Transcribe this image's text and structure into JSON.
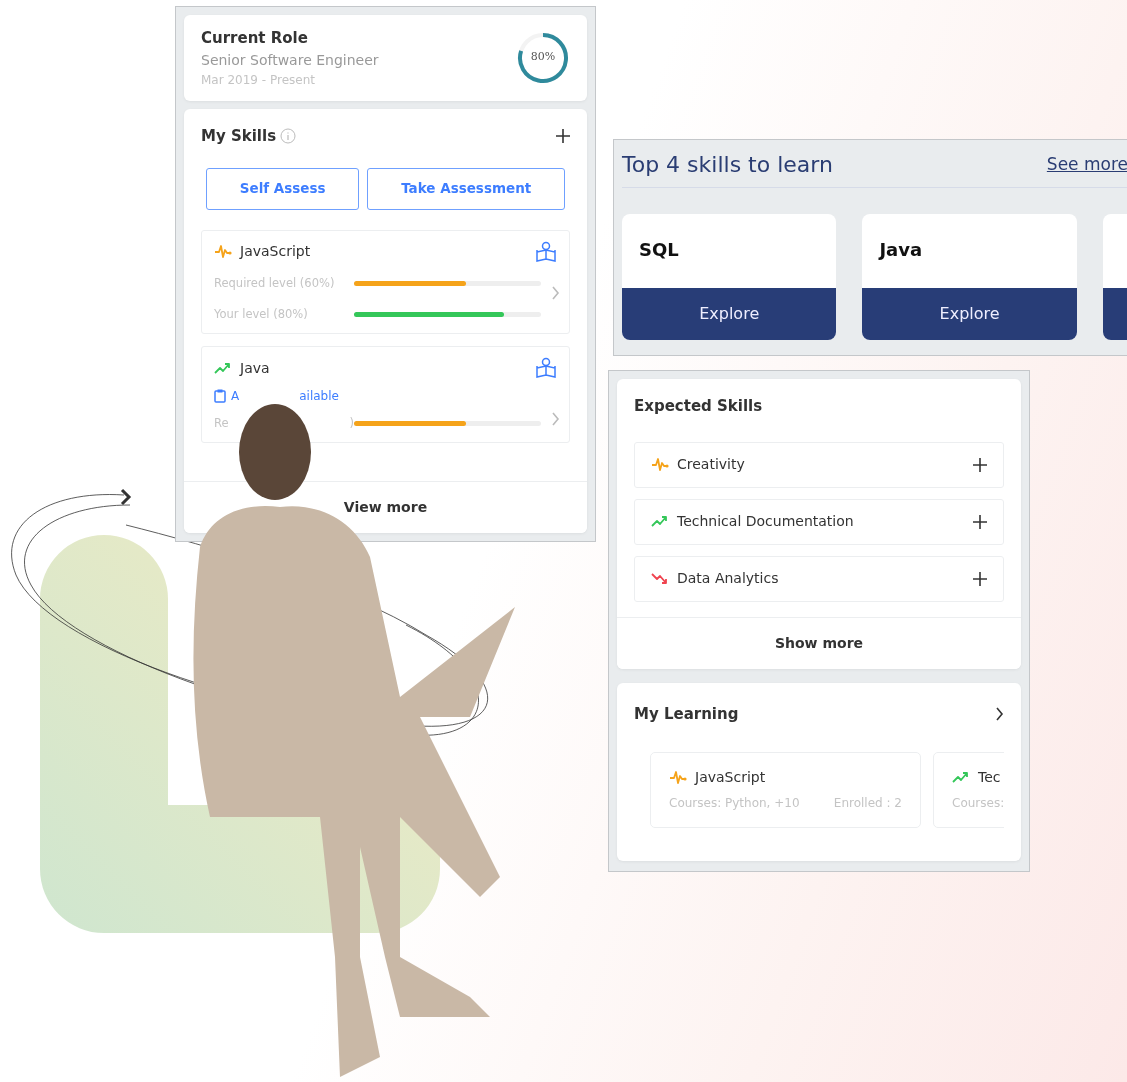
{
  "current_role": {
    "title": "Current Role",
    "role": "Senior Software Engineer",
    "period": "Mar 2019 - Present",
    "progress": {
      "level": 0.8,
      "reading": "80%"
    }
  },
  "my_skills": {
    "title": "My Skills",
    "buttons": [
      "Self Assess",
      "Take Assessment"
    ],
    "skills": [
      {
        "name": "JavaScript",
        "kind": "steady",
        "rows": [
          {
            "kind": "required",
            "label": "Required level (60%)",
            "level": 0.6
          },
          {
            "kind": "yours",
            "label": "Your level (80%)",
            "level": 0.8
          }
        ]
      },
      {
        "name": "Java",
        "kind": "up",
        "link_parts": [
          "A",
          "ailable"
        ],
        "rows": [
          {
            "kind": "required",
            "label_parts": [
              "Re",
              ")"
            ],
            "level": 0.6
          }
        ]
      }
    ],
    "footer": "View more"
  },
  "top_skills": {
    "title": "Top 4 skills to learn",
    "link": "See more",
    "cards": [
      {
        "name": "SQL",
        "action": "Explore"
      },
      {
        "name": "Java",
        "action": "Explore"
      }
    ]
  },
  "expected_skills": {
    "title": "Expected Skills",
    "items": [
      {
        "name": "Creativity",
        "kind": "steady"
      },
      {
        "name": "Technical Documentation",
        "kind": "up"
      },
      {
        "name": "Data Analytics",
        "kind": "down"
      }
    ],
    "footer": "Show more"
  },
  "my_learning": {
    "title": "My Learning",
    "cards": [
      {
        "name": "JavaScript",
        "kind": "steady",
        "courses": "Courses: Python, +10",
        "enrolled": "Enrolled : 2"
      },
      {
        "name": "Tec",
        "kind": "up",
        "courses": "Courses:"
      }
    ]
  }
}
